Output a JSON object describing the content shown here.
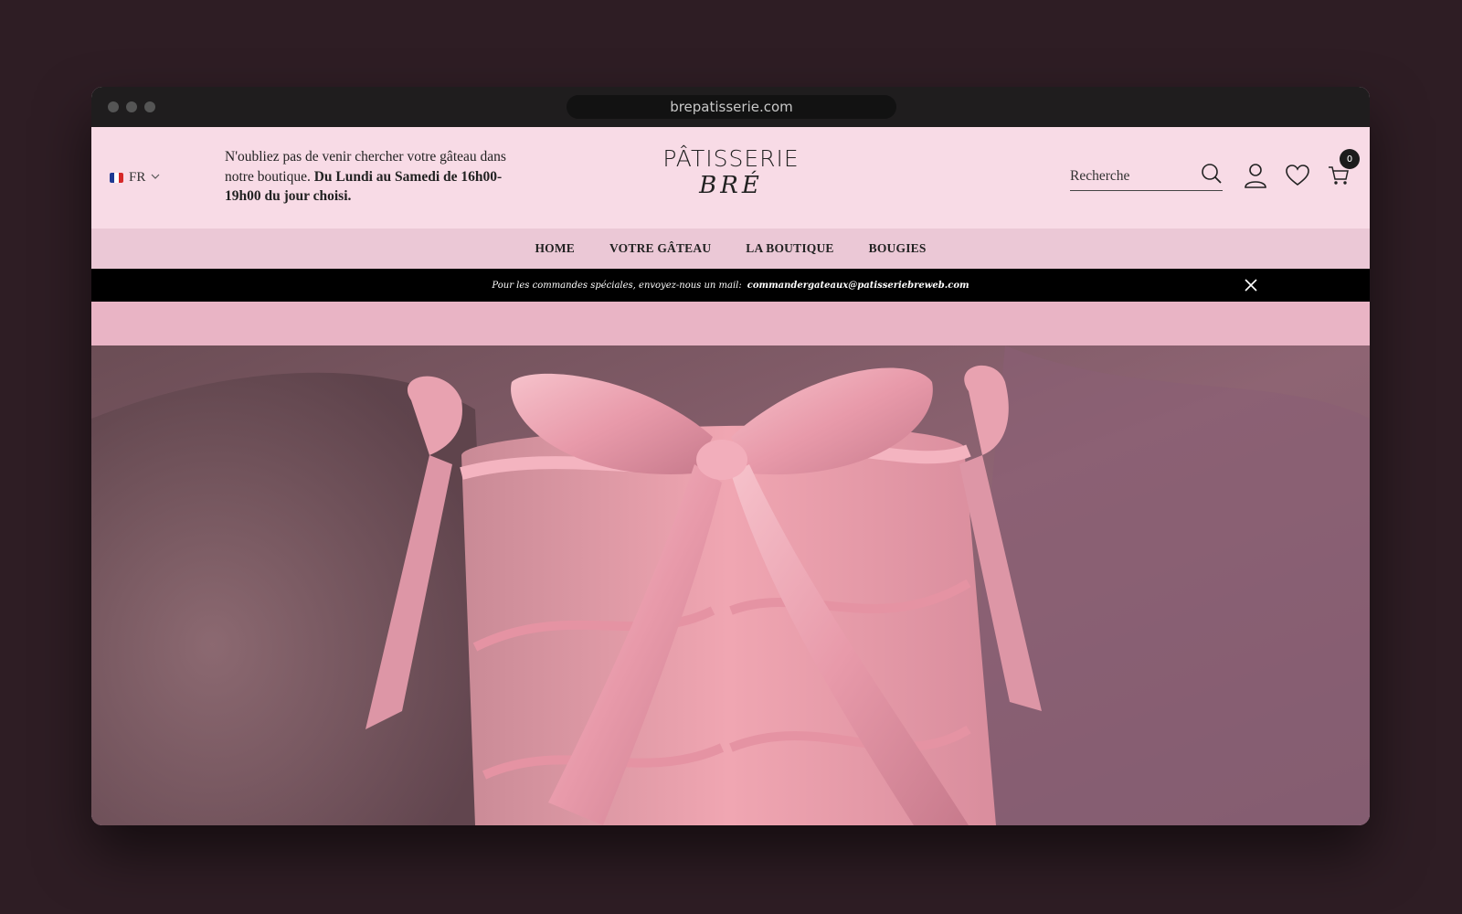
{
  "browser": {
    "url": "brepatisserie.com"
  },
  "header": {
    "language": "FR",
    "notice_text": "N'oubliez pas de venir chercher votre gâteau dans notre boutique.",
    "notice_bold": "Du Lundi au Samedi de 16h00-19h00 du jour choisi.",
    "logo_top": "PÂTISSERIE",
    "logo_bottom": "BRÉ",
    "search_placeholder": "Recherche",
    "cart_count": "0"
  },
  "nav": {
    "items": [
      {
        "label": "HOME"
      },
      {
        "label": "VOTRE GÂTEAU"
      },
      {
        "label": "LA BOUTIQUE"
      },
      {
        "label": "BOUGIES"
      }
    ]
  },
  "announcement": {
    "text": "Pour les commandes spéciales, envoyez-nous un mail:",
    "email": "commandergateaux@patisseriebreweb.com"
  },
  "colors": {
    "header_bg": "#f8dbe6",
    "nav_bg": "#ebc8d6",
    "announcement_bg": "#000000",
    "page_bg": "#2e1d24"
  },
  "icons": [
    "search-icon",
    "account-icon",
    "wishlist-heart-icon",
    "cart-icon",
    "close-icon",
    "chevron-down-icon"
  ]
}
